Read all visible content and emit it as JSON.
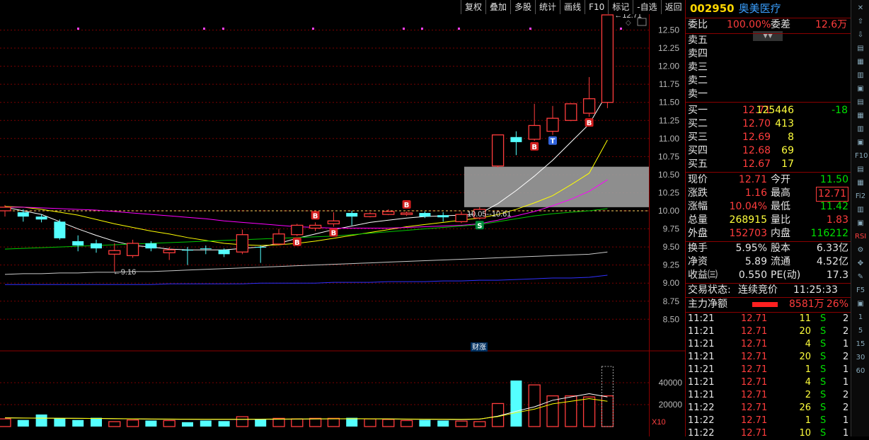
{
  "toolbar": [
    "复权",
    "叠加",
    "多股",
    "统计",
    "画线",
    "F10",
    "标记",
    "-自选",
    "返回"
  ],
  "stock": {
    "code": "002950",
    "name": "奥美医疗"
  },
  "order_book": {
    "weibi_label": "委比",
    "weibi": "100.00%",
    "weicha_label": "委差",
    "weicha": "12.6万",
    "asks": [
      {
        "label": "卖五"
      },
      {
        "label": "卖四"
      },
      {
        "label": "卖三"
      },
      {
        "label": "卖二"
      },
      {
        "label": "卖一"
      }
    ],
    "bids": [
      {
        "label": "买一",
        "price": "12.71",
        "volume": "125446",
        "change": "-18"
      },
      {
        "label": "买二",
        "price": "12.70",
        "volume": "413",
        "change": ""
      },
      {
        "label": "买三",
        "price": "12.69",
        "volume": "8",
        "change": ""
      },
      {
        "label": "买四",
        "price": "12.68",
        "volume": "69",
        "change": ""
      },
      {
        "label": "买五",
        "price": "12.67",
        "volume": "17",
        "change": ""
      }
    ]
  },
  "quote": [
    {
      "l1": "现价",
      "v1": "12.71",
      "c1": "red",
      "l2": "今开",
      "v2": "11.50",
      "c2": "green"
    },
    {
      "l1": "涨跌",
      "v1": "1.16",
      "c1": "red",
      "l2": "最高",
      "v2": "12.71",
      "c2": "red"
    },
    {
      "l1": "涨幅",
      "v1": "10.04%",
      "c1": "red",
      "l2": "最低",
      "v2": "11.42",
      "c2": "green"
    },
    {
      "l1": "总量",
      "v1": "268915",
      "c1": "yellow",
      "l2": "量比",
      "v2": "1.83",
      "c2": "red"
    },
    {
      "l1": "外盘",
      "v1": "152703",
      "c1": "red",
      "l2": "内盘",
      "v2": "116212",
      "c2": "green"
    }
  ],
  "stats": [
    {
      "l1": "换手",
      "v1": "5.95%",
      "l2": "股本",
      "v2": "6.33亿"
    },
    {
      "l1": "净资",
      "v1": "5.89",
      "l2": "流通",
      "v2": "4.52亿"
    },
    {
      "l1": "收益㈢",
      "v1": "0.550",
      "l2": "PE(动)",
      "v2": "17.3"
    }
  ],
  "trade_status": {
    "label": "交易状态:",
    "value": "连续竞价",
    "time": "11:25:33"
  },
  "main_flow": {
    "label": "主力净额",
    "value": "8581万",
    "pct": "26%"
  },
  "ticks": [
    {
      "time": "11:21",
      "price": "12.71",
      "vol": "11",
      "side": "S",
      "n": "2"
    },
    {
      "time": "11:21",
      "price": "12.71",
      "vol": "20",
      "side": "S",
      "n": "2"
    },
    {
      "time": "11:21",
      "price": "12.71",
      "vol": "4",
      "side": "S",
      "n": "1"
    },
    {
      "time": "11:21",
      "price": "12.71",
      "vol": "20",
      "side": "S",
      "n": "2"
    },
    {
      "time": "11:21",
      "price": "12.71",
      "vol": "1",
      "side": "S",
      "n": "1"
    },
    {
      "time": "11:21",
      "price": "12.71",
      "vol": "4",
      "side": "S",
      "n": "1"
    },
    {
      "time": "11:21",
      "price": "12.71",
      "vol": "2",
      "side": "S",
      "n": "2"
    },
    {
      "time": "11:22",
      "price": "12.71",
      "vol": "26",
      "side": "S",
      "n": "2"
    },
    {
      "time": "11:22",
      "price": "12.71",
      "vol": "1",
      "side": "S",
      "n": "1"
    },
    {
      "time": "11:22",
      "price": "12.71",
      "vol": "10",
      "side": "S",
      "n": "1"
    }
  ],
  "sidebar_labels": [
    "RSI",
    "F5",
    "1",
    "5",
    "15",
    "30",
    "60"
  ],
  "chart_data": {
    "type": "candlestick",
    "price_axis": {
      "ticks": [
        "12.50",
        "12.25",
        "12.00",
        "11.75",
        "11.50",
        "11.25",
        "11.00",
        "10.75",
        "10.50",
        "10.25",
        "10.00",
        "9.75",
        "9.50",
        "9.25",
        "9.00",
        "8.75",
        "8.50"
      ],
      "range": [
        8.5,
        12.5
      ]
    },
    "volume_axis": {
      "ticks": [
        "40000",
        "20000"
      ],
      "unit_label": "X10"
    },
    "candles": [
      {
        "o": 10.0,
        "c": 10.05,
        "h": 10.08,
        "l": 9.92
      },
      {
        "o": 9.98,
        "c": 9.92,
        "h": 10.02,
        "l": 9.85
      },
      {
        "o": 9.92,
        "c": 9.88,
        "h": 9.95,
        "l": 9.84
      },
      {
        "o": 9.85,
        "c": 9.62,
        "h": 9.88,
        "l": 9.6
      },
      {
        "o": 9.58,
        "c": 9.52,
        "h": 9.66,
        "l": 9.44
      },
      {
        "o": 9.55,
        "c": 9.48,
        "h": 9.6,
        "l": 9.42
      },
      {
        "o": 9.4,
        "c": 9.45,
        "h": 9.55,
        "l": 9.16
      },
      {
        "o": 9.38,
        "c": 9.55,
        "h": 9.6,
        "l": 9.35
      },
      {
        "o": 9.55,
        "c": 9.48,
        "h": 9.58,
        "l": 9.44
      },
      {
        "o": 9.42,
        "c": 9.46,
        "h": 9.5,
        "l": 9.32
      },
      {
        "o": 9.46,
        "c": 9.45,
        "h": 9.5,
        "l": 9.25
      },
      {
        "o": 9.48,
        "c": 9.47,
        "h": 9.52,
        "l": 9.4
      },
      {
        "o": 9.46,
        "c": 9.4,
        "h": 9.48,
        "l": 9.36
      },
      {
        "o": 9.43,
        "c": 9.67,
        "h": 9.74,
        "l": 9.4
      },
      {
        "o": 9.5,
        "c": 9.49,
        "h": 9.52,
        "l": 9.28
      },
      {
        "o": 9.54,
        "c": 9.68,
        "h": 9.75,
        "l": 9.52
      },
      {
        "o": 9.67,
        "c": 9.8,
        "h": 9.82,
        "l": 9.65
      },
      {
        "o": 9.76,
        "c": 9.8,
        "h": 9.84,
        "l": 9.72
      },
      {
        "o": 9.82,
        "c": 9.86,
        "h": 9.98,
        "l": 9.78
      },
      {
        "o": 9.97,
        "c": 9.92,
        "h": 10.0,
        "l": 9.8
      },
      {
        "o": 9.92,
        "c": 9.96,
        "h": 9.98,
        "l": 9.91
      },
      {
        "o": 9.95,
        "c": 9.99,
        "h": 10.02,
        "l": 9.94
      },
      {
        "o": 9.95,
        "c": 9.97,
        "h": 9.99,
        "l": 9.93
      },
      {
        "o": 9.97,
        "c": 9.92,
        "h": 9.99,
        "l": 9.9
      },
      {
        "o": 9.94,
        "c": 9.91,
        "h": 9.98,
        "l": 9.85
      },
      {
        "o": 9.85,
        "c": 9.95,
        "h": 9.99,
        "l": 9.83
      },
      {
        "o": 9.9,
        "c": 10.02,
        "h": 10.05,
        "l": 9.88
      },
      {
        "o": 10.62,
        "c": 11.05,
        "h": 11.05,
        "l": 10.6
      },
      {
        "o": 11.02,
        "c": 10.95,
        "h": 11.1,
        "l": 10.77
      },
      {
        "o": 10.99,
        "c": 11.18,
        "h": 11.48,
        "l": 10.97
      },
      {
        "o": 11.1,
        "c": 11.28,
        "h": 11.45,
        "l": 11.05
      },
      {
        "o": 11.25,
        "c": 11.48,
        "h": 11.49,
        "l": 11.24
      },
      {
        "o": 11.35,
        "c": 11.55,
        "h": 11.85,
        "l": 11.3
      },
      {
        "o": 11.5,
        "c": 12.71,
        "h": 12.71,
        "l": 11.42
      }
    ],
    "ma_series": [
      {
        "color": "#ffffff",
        "values": [
          10.05,
          10.0,
          9.95,
          9.85,
          9.75,
          9.66,
          9.58,
          9.52,
          9.5,
          9.47,
          9.46,
          9.46,
          9.46,
          9.48,
          9.5,
          9.55,
          9.62,
          9.68,
          9.74,
          9.79,
          9.84,
          9.87,
          9.9,
          9.92,
          9.93,
          9.94,
          9.96,
          10.1,
          10.28,
          10.48,
          10.7,
          10.95,
          11.2,
          11.63
        ]
      },
      {
        "color": "#ffff00",
        "values": [
          10.06,
          10.05,
          10.02,
          9.98,
          9.94,
          9.88,
          9.82,
          9.77,
          9.72,
          9.68,
          9.63,
          9.59,
          9.55,
          9.53,
          9.52,
          9.53,
          9.55,
          9.58,
          9.62,
          9.66,
          9.7,
          9.74,
          9.78,
          9.81,
          9.84,
          9.87,
          9.9,
          9.95,
          10.02,
          10.11,
          10.21,
          10.36,
          10.52,
          10.98
        ]
      },
      {
        "color": "#ff00ff",
        "values": [
          10.05,
          10.05,
          10.04,
          10.03,
          10.02,
          10.01,
          9.99,
          9.97,
          9.95,
          9.93,
          9.91,
          9.89,
          9.86,
          9.84,
          9.82,
          9.8,
          9.78,
          9.77,
          9.76,
          9.76,
          9.76,
          9.76,
          9.77,
          9.78,
          9.79,
          9.8,
          9.82,
          9.87,
          9.93,
          9.99,
          10.07,
          10.16,
          10.27,
          10.43
        ]
      },
      {
        "color": "#00c800",
        "values": [
          9.47,
          9.48,
          9.49,
          9.5,
          9.51,
          9.52,
          9.53,
          9.54,
          9.55,
          9.56,
          9.57,
          9.58,
          9.59,
          9.6,
          9.61,
          9.62,
          9.63,
          9.64,
          9.65,
          9.67,
          9.69,
          9.71,
          9.73,
          9.75,
          9.77,
          9.79,
          9.81,
          9.85,
          9.89,
          9.93,
          9.96,
          9.98,
          10.0,
          10.03
        ]
      },
      {
        "color": "#c8c8c8",
        "values": [
          9.12,
          9.13,
          9.13,
          9.14,
          9.14,
          9.15,
          9.15,
          9.16,
          9.16,
          9.17,
          9.18,
          9.19,
          9.2,
          9.21,
          9.22,
          9.23,
          9.24,
          9.25,
          9.26,
          9.27,
          9.28,
          9.29,
          9.3,
          9.31,
          9.32,
          9.33,
          9.34,
          9.35,
          9.36,
          9.37,
          9.38,
          9.39,
          9.4,
          9.43
        ]
      },
      {
        "color": "#3030ff",
        "values": [
          8.98,
          8.98,
          8.98,
          8.98,
          8.98,
          8.98,
          8.98,
          8.98,
          8.98,
          8.99,
          8.99,
          8.99,
          8.99,
          8.99,
          9.0,
          9.0,
          9.0,
          9.0,
          9.01,
          9.01,
          9.01,
          9.02,
          9.02,
          9.02,
          9.03,
          9.03,
          9.04,
          9.04,
          9.05,
          9.06,
          9.07,
          9.07,
          9.08,
          9.11
        ]
      }
    ],
    "volumes": [
      7000,
      6000,
      11000,
      7500,
      6000,
      8000,
      4500,
      6000,
      5500,
      5500,
      4000,
      5500,
      5000,
      9000,
      6500,
      7500,
      7000,
      7500,
      7500,
      8000,
      7000,
      6500,
      5500,
      6000,
      5500,
      5000,
      4500,
      21000,
      42000,
      38000,
      28000,
      28000,
      27000,
      28000
    ],
    "vol_ma": [
      8000,
      7800,
      7700,
      7600,
      7500,
      7400,
      7200,
      7000,
      6800,
      6700,
      6600,
      6500,
      6500,
      6500,
      6600,
      6700,
      6800,
      6900,
      7000,
      7100,
      7000,
      6900,
      6700,
      6600,
      6500,
      6400,
      6800,
      9500,
      14000,
      18000,
      24000,
      27000,
      30000,
      27000
    ],
    "markers": [
      {
        "idx": 16,
        "label": "B",
        "pos": "below"
      },
      {
        "idx": 17,
        "label": "B",
        "pos": "above"
      },
      {
        "idx": 18,
        "label": "B",
        "pos": "below"
      },
      {
        "idx": 22,
        "label": "B",
        "pos": "above"
      },
      {
        "idx": 26,
        "label": "S",
        "pos": "below"
      },
      {
        "idx": 29,
        "label": "B",
        "pos": "below"
      },
      {
        "idx": 30,
        "label": "T",
        "pos": "below"
      },
      {
        "idx": 32,
        "label": "B",
        "pos": "below"
      }
    ],
    "annotations": {
      "high_label": "12.71",
      "low_label": "9.16",
      "box_label": "10.05--10.61",
      "finance_label": "财涨"
    },
    "zone": {
      "low": 10.05,
      "high": 10.61
    },
    "ref_line": 10.0
  }
}
